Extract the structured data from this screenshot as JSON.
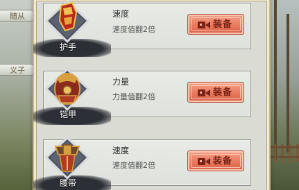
{
  "side_tabs": [
    {
      "label": "随从"
    },
    {
      "label": "义子"
    }
  ],
  "items": [
    {
      "name": "护手",
      "attr_title": "速度",
      "attr_desc": "速度值翻2倍",
      "button_label": "装备",
      "button_icon": "video-camera-icon"
    },
    {
      "name": "铠甲",
      "attr_title": "力量",
      "attr_desc": "力量值翻2倍",
      "button_label": "装备",
      "button_icon": "video-camera-icon"
    },
    {
      "name": "腰带",
      "attr_title": "速度",
      "attr_desc": "速度值翻2倍",
      "button_label": "装备",
      "button_icon": "video-camera-icon"
    }
  ],
  "colors": {
    "button_fill": "#e87a5f",
    "button_text": "#7a2314",
    "card_bg": "#e8eae5",
    "panel_bg": "#dadcd4"
  }
}
